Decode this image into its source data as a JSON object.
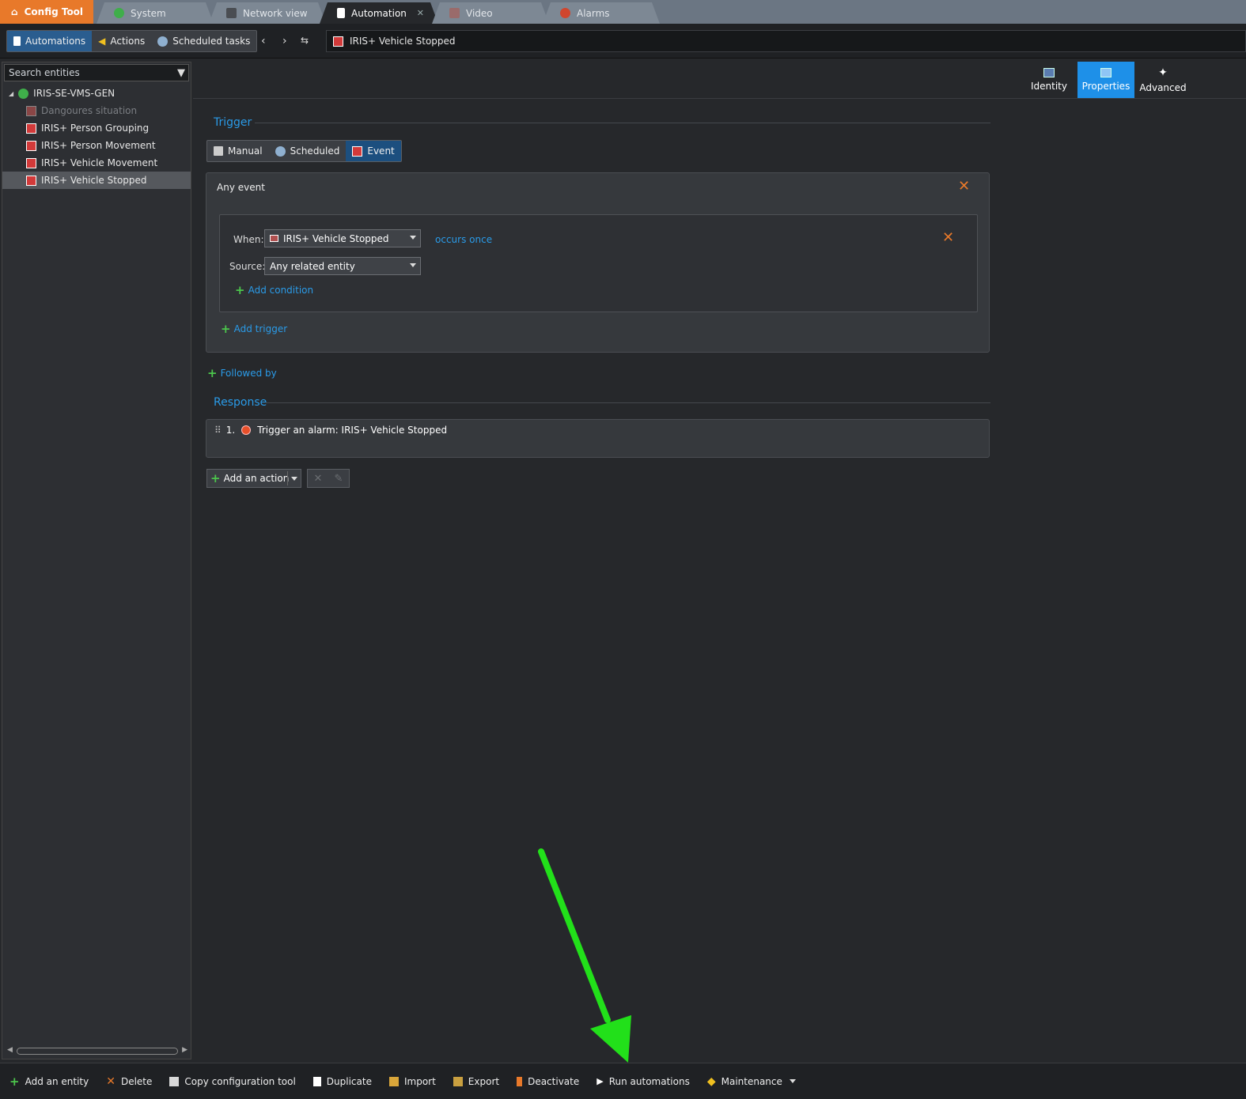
{
  "tabs": {
    "app": "Config Tool",
    "items": [
      {
        "label": "System",
        "icon": "system-icon",
        "color": "#3fae4a"
      },
      {
        "label": "Network view",
        "icon": "network-icon",
        "color": "#555"
      },
      {
        "label": "Automation",
        "icon": "automation-icon",
        "color": "#fff"
      },
      {
        "label": "Video",
        "icon": "video-icon",
        "color": "#a66"
      },
      {
        "label": "Alarms",
        "icon": "alarm-icon",
        "color": "#d0462e"
      }
    ],
    "close_glyph": "✕"
  },
  "toolbar": {
    "automations": "Automations",
    "actions": "Actions",
    "scheduled_tasks": "Scheduled tasks",
    "breadcrumb": "IRIS+ Vehicle Stopped"
  },
  "sidebar": {
    "search_placeholder": "Search entities",
    "root": "IRIS-SE-VMS-GEN",
    "items": [
      {
        "label": "Dangoures situation"
      },
      {
        "label": "IRIS+ Person Grouping"
      },
      {
        "label": "IRIS+ Person Movement"
      },
      {
        "label": "IRIS+ Vehicle Movement"
      },
      {
        "label": "IRIS+ Vehicle Stopped"
      }
    ]
  },
  "page_tabs": {
    "identity": "Identity",
    "properties": "Properties",
    "advanced": "Advanced"
  },
  "trigger": {
    "heading": "Trigger",
    "modes": {
      "manual": "Manual",
      "scheduled": "Scheduled",
      "event": "Event"
    },
    "panel_title": "Any event",
    "when_label": "When:",
    "when_value": "IRIS+ Vehicle Stopped",
    "occurs": "occurs once",
    "source_label": "Source:",
    "source_value": "Any related entity",
    "add_condition": "Add condition",
    "add_trigger": "Add trigger",
    "followed_by": "Followed by"
  },
  "response": {
    "heading": "Response",
    "item_number": "1.",
    "item_text": "Trigger an alarm: IRIS+ Vehicle Stopped",
    "add_action": "Add an action"
  },
  "bottom": {
    "add_entity": "Add an entity",
    "delete": "Delete",
    "copy_config": "Copy configuration tool",
    "duplicate": "Duplicate",
    "import": "Import",
    "export": "Export",
    "deactivate": "Deactivate",
    "run": "Run automations",
    "maintenance": "Maintenance"
  },
  "colors": {
    "accent": "#2a9be8",
    "app_orange": "#e8792a",
    "annotation_green": "#22e01a"
  }
}
